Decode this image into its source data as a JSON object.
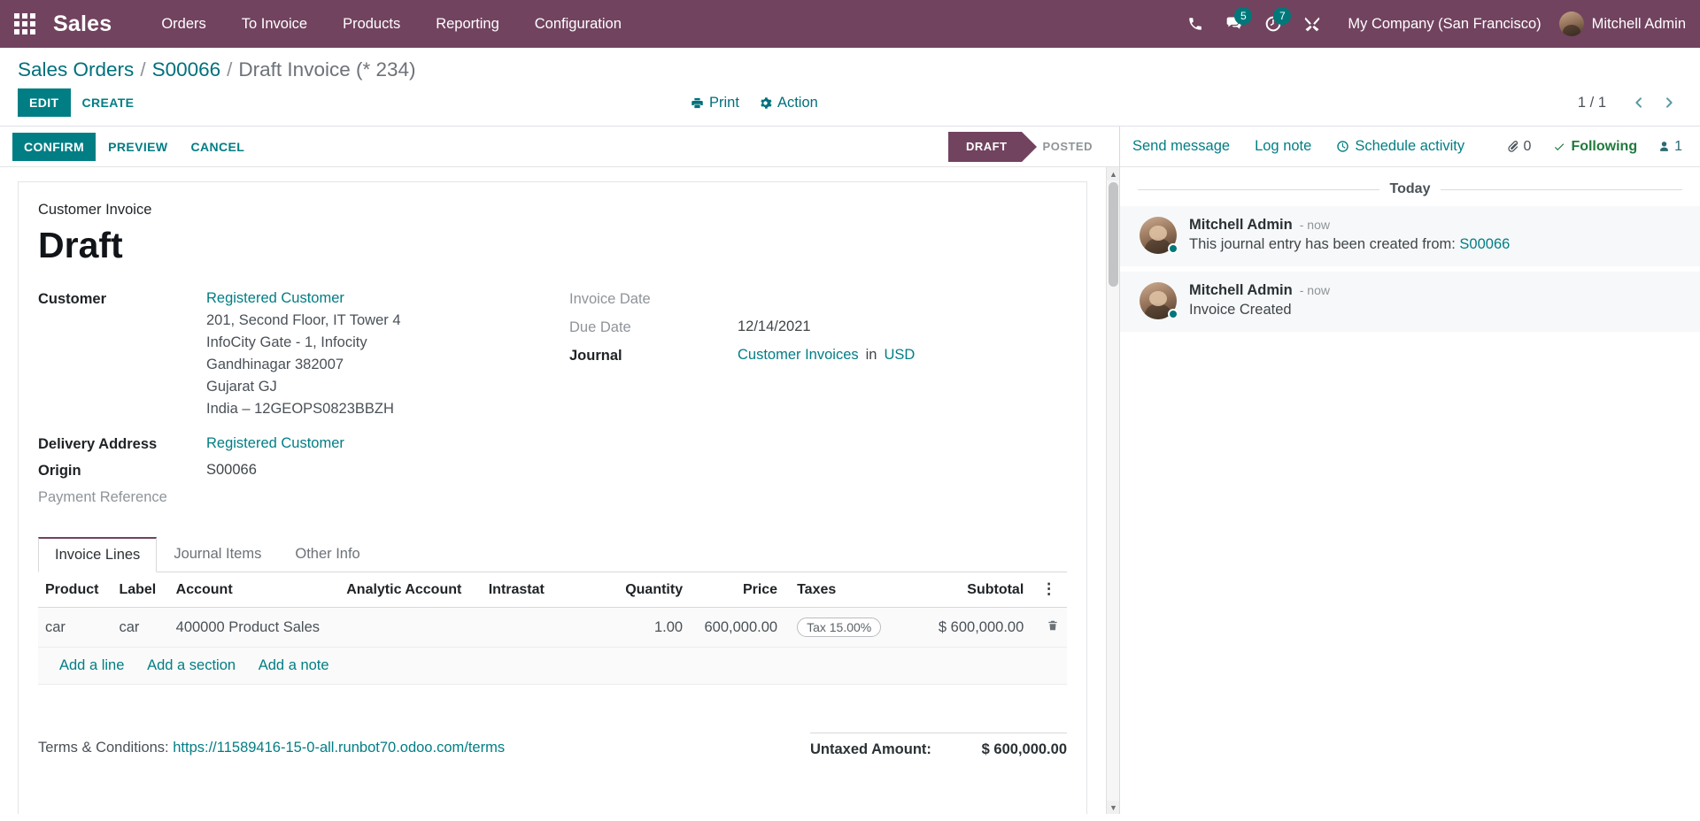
{
  "navbar": {
    "apps_icon": "apps-grid-icon",
    "brand": "Sales",
    "menu": [
      {
        "label": "Orders"
      },
      {
        "label": "To Invoice"
      },
      {
        "label": "Products"
      },
      {
        "label": "Reporting"
      },
      {
        "label": "Configuration"
      }
    ],
    "icons": {
      "phone": "phone-icon",
      "messages": "messages-icon",
      "activities": "activities-clock-icon",
      "tools": "developer-tools-icon"
    },
    "messages_count": "5",
    "activities_count": "7",
    "company": "My Company (San Francisco)",
    "user": "Mitchell Admin"
  },
  "control_panel": {
    "breadcrumb": {
      "root": "Sales Orders",
      "sep": "/",
      "parent": "S00066",
      "current": "Draft Invoice (* 234)"
    },
    "edit_label": "EDIT",
    "create_label": "CREATE",
    "print_label": "Print",
    "action_label": "Action",
    "pager": "1 / 1"
  },
  "statusbar": {
    "confirm_label": "CONFIRM",
    "preview_label": "PREVIEW",
    "cancel_label": "CANCEL",
    "states": [
      {
        "label": "DRAFT",
        "active": true
      },
      {
        "label": "POSTED",
        "active": false
      }
    ]
  },
  "form": {
    "doc_type": "Customer Invoice",
    "title": "Draft",
    "customer_label": "Customer",
    "customer_name": "Registered Customer",
    "customer_address": [
      "201, Second Floor, IT Tower 4",
      "InfoCity Gate - 1, Infocity",
      "Gandhinagar 382007",
      "Gujarat GJ",
      "India – 12GEOPS0823BBZH"
    ],
    "delivery_address_label": "Delivery Address",
    "delivery_address_value": "Registered Customer",
    "origin_label": "Origin",
    "origin_value": "S00066",
    "payment_reference_label": "Payment Reference",
    "payment_reference_value": "",
    "invoice_date_label": "Invoice Date",
    "invoice_date_value": "",
    "due_date_label": "Due Date",
    "due_date_value": "12/14/2021",
    "journal_label": "Journal",
    "journal_value": "Customer Invoices",
    "journal_in": "in",
    "currency": "USD"
  },
  "notebook": {
    "tabs": [
      {
        "label": "Invoice Lines",
        "active": true
      },
      {
        "label": "Journal Items",
        "active": false
      },
      {
        "label": "Other Info",
        "active": false
      }
    ],
    "columns": [
      "Product",
      "Label",
      "Account",
      "Analytic Account",
      "Intrastat",
      "Quantity",
      "Price",
      "Taxes",
      "Subtotal"
    ],
    "rows": [
      {
        "product": "car",
        "label": "car",
        "account": "400000 Product Sales",
        "analytic_account": "",
        "intrastat": "",
        "quantity": "1.00",
        "price": "600,000.00",
        "taxes": "Tax 15.00%",
        "subtotal": "$ 600,000.00",
        "delete_icon": "trash-icon"
      }
    ],
    "add_line": "Add a line",
    "add_section": "Add a section",
    "add_note": "Add a note",
    "optional_columns_icon": "vertical-dots-icon"
  },
  "footer": {
    "terms_label": "Terms & Conditions:",
    "terms_url": "https://11589416-15-0-all.runbot70.odoo.com/terms",
    "untaxed_label": "Untaxed Amount:",
    "untaxed_value": "$ 600,000.00"
  },
  "chatter": {
    "send_message": "Send message",
    "log_note": "Log note",
    "schedule_activity": "Schedule activity",
    "attachment_count": "0",
    "following_label": "Following",
    "followers_count": "1",
    "day_separator": "Today",
    "messages": [
      {
        "author": "Mitchell Admin",
        "time": "- now",
        "text": "This journal entry has been created from: ",
        "link": "S00066"
      },
      {
        "author": "Mitchell Admin",
        "time": "- now",
        "text": "Invoice Created",
        "link": ""
      }
    ]
  },
  "colors": {
    "navbar_bg": "#71435f",
    "accent": "#017e84",
    "badge": "#00787a",
    "status_active": "#71435f",
    "following_green": "#1e7a3c"
  }
}
